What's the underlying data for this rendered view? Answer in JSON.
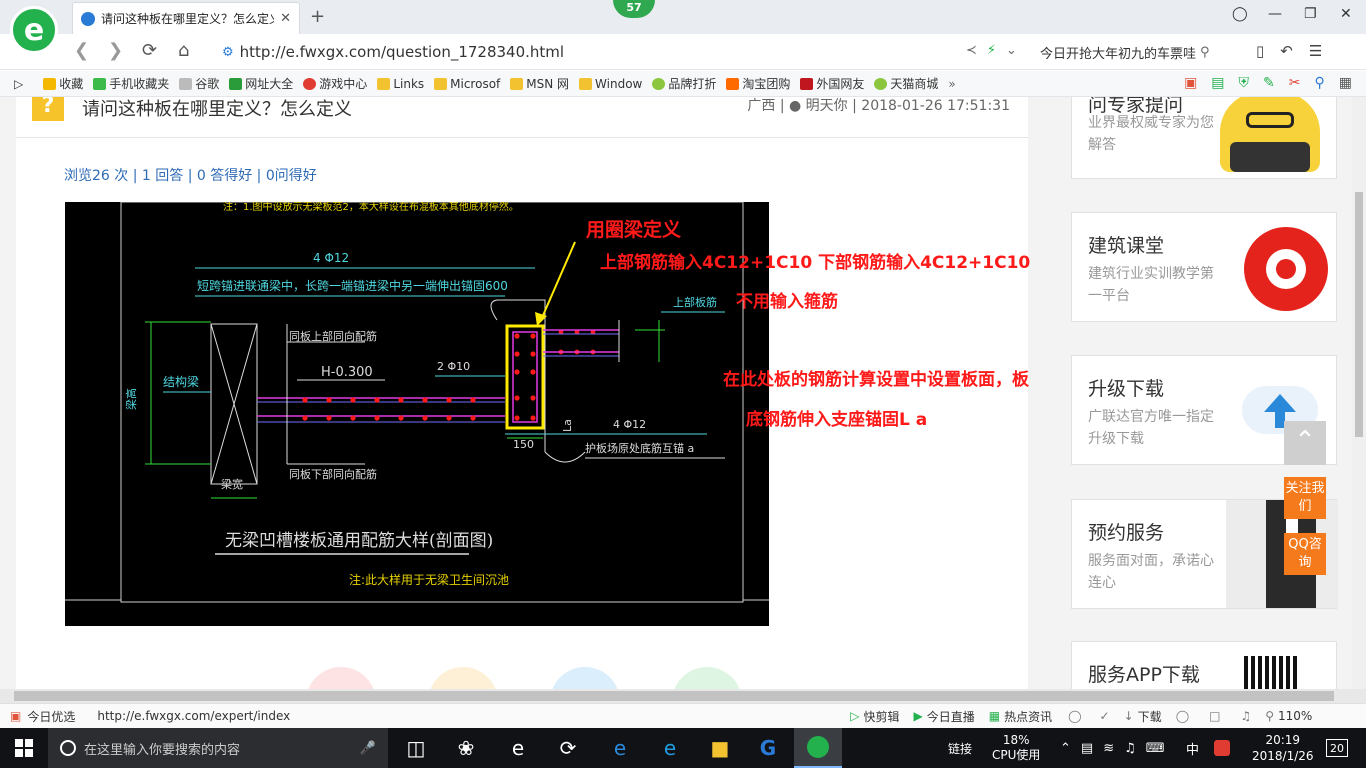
{
  "browser": {
    "logo_letter": "e",
    "tab_title": "请问这种板在哪里定义？怎么定义",
    "tab_close": "✕",
    "new_tab": "+",
    "badge": "57",
    "url": "http://e.fwxgx.com/question_1728340.html",
    "search_text": "今日开抢大年初九的车票哇",
    "bookmarks": [
      {
        "label": "收藏",
        "color": "#f5b800"
      },
      {
        "label": "手机收藏夹",
        "color": "#3dbb4a"
      },
      {
        "label": "谷歌",
        "color": "#bbbbbb"
      },
      {
        "label": "网址大全",
        "color": "#2a9d3a"
      },
      {
        "label": "游戏中心",
        "color": "#e03c31"
      },
      {
        "label": "Links",
        "color": "#f2c230"
      },
      {
        "label": "Microsof",
        "color": "#f2c230"
      },
      {
        "label": "MSN 网",
        "color": "#f2c230"
      },
      {
        "label": "Window",
        "color": "#f2c230"
      },
      {
        "label": "品牌打折",
        "color": "#8cc63f"
      },
      {
        "label": "淘宝团购",
        "color": "#ff6a00"
      },
      {
        "label": "外国网友",
        "color": "#c0161f"
      },
      {
        "label": "天猫商城",
        "color": "#8cc63f"
      }
    ]
  },
  "question": {
    "title": "请问这种板在哪里定义？怎么定义",
    "region": "广西",
    "author": "明天你",
    "datetime": "2018-01-26 17:51:31",
    "stats": "浏览26 次 | 1 回答 | 0 答得好 | 0问得好"
  },
  "drawing": {
    "note_top": "注：1.图中设放示无梁板范2，本大样设在布混板本其他底材停然。",
    "bar_top": "4 Φ12",
    "anchor_text": "短跨锚进联通梁中，长跨一端锚进梁中另一端伸出锚固600",
    "side_label": "上部板筋",
    "same_top": "同板上部同向配筋",
    "level": "H-0.300",
    "bar_mid": "2 Φ10",
    "left_beam": "结构梁",
    "left_span": "梁宽",
    "beam_depth": "梁高",
    "same_bottom": "同板下部同向配筋",
    "width_150": "150",
    "bar_bottom": "4 Φ12",
    "bottom_text": "护板场原处底筋互锚 a",
    "la": "La",
    "main_title": "无梁凹槽楼板通用配筋大样(剖面图)",
    "footnote": "注:此大样用于无梁卫生间沉池",
    "ann_1": "用圈梁定义",
    "ann_2": "上部钢筋输入4C12+1C10  下部钢筋输入4C12+1C10",
    "ann_3": "不用输入箍筋",
    "ann_4": "在此处板的钢筋计算设置中设置板面，板",
    "ann_5": "底钢筋伸入支座锚固L a"
  },
  "sidebar": {
    "card1_title": "问专家提问",
    "card1_sub": "业界最权威专家为您解答",
    "card2_title": "建筑课堂",
    "card2_sub": "建筑行业实训教学第一平台",
    "card3_title": "升级下载",
    "card3_sub": "广联达官方唯一指定升级下载",
    "card4_title": "预约服务",
    "card4_sub": "服务面对面，承诺心连心",
    "card5_title": "服务APP下载",
    "follow": "关注我们",
    "qq": "QQ咨询"
  },
  "status": {
    "left": "今日优选",
    "url": "http://e.fwxgx.com/expert/index",
    "kuaijianji": "快剪辑",
    "live": "今日直播",
    "news": "热点资讯",
    "download": "下载",
    "zoom": "110%"
  },
  "taskbar": {
    "search_placeholder": "在这里输入你要搜索的内容",
    "link": "链接",
    "cpu_pct": "18%",
    "cpu_label": "CPU使用",
    "ime": "中",
    "time": "20:19",
    "date": "2018/1/26",
    "notif": "20"
  },
  "colors": {
    "accent_green": "#22b14c",
    "link_blue": "#2f6bb5",
    "ann_red": "#ff1a1a",
    "float_orange": "#f57a1c"
  }
}
